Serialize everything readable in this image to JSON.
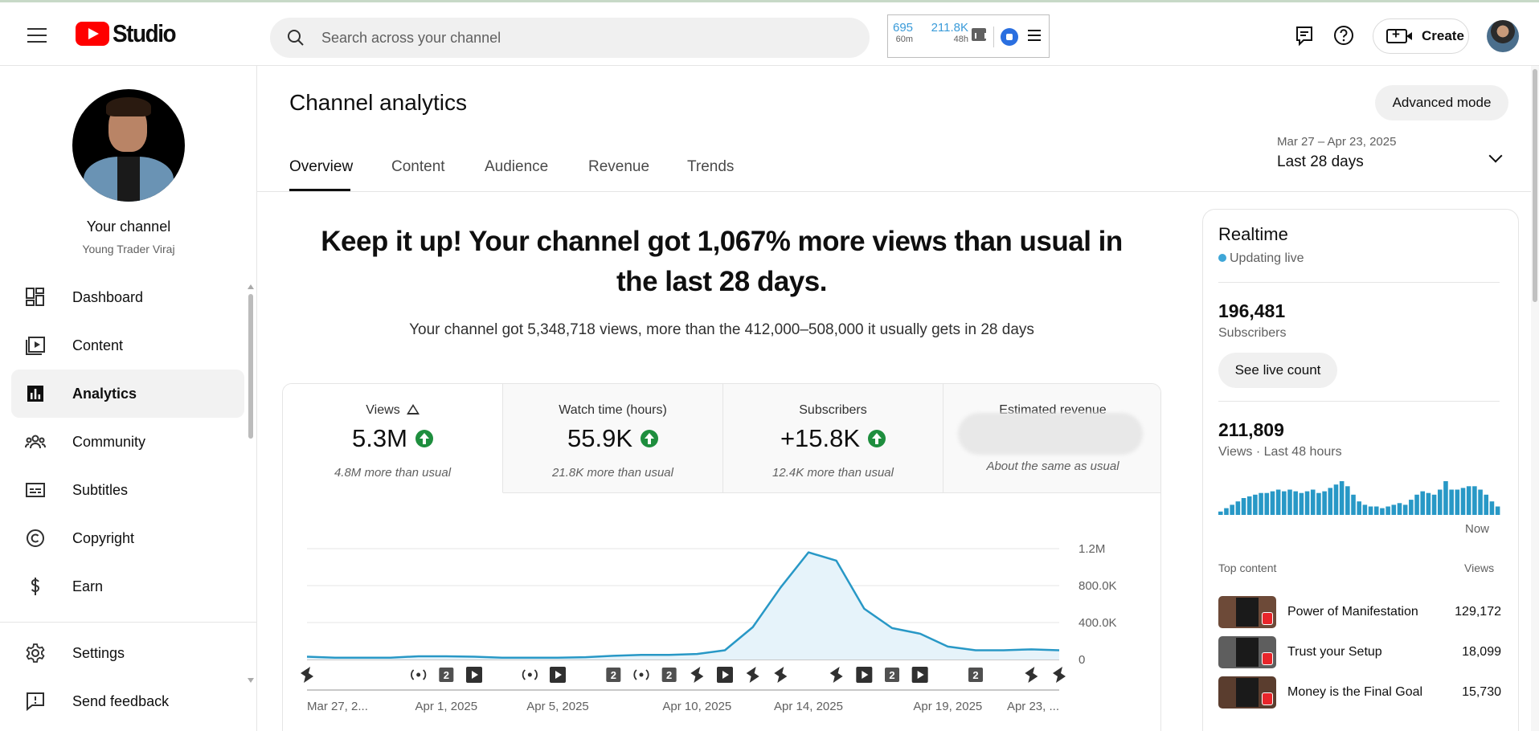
{
  "app": {
    "logo_text": "Studio"
  },
  "search": {
    "placeholder": "Search across your channel"
  },
  "extension": {
    "views_60m": "695",
    "views_60m_label": "60m",
    "views_48h": "211.8K",
    "views_48h_label": "48h"
  },
  "topbar": {
    "create_label": "Create"
  },
  "sidebar": {
    "channel_title": "Your channel",
    "channel_name": "Young Trader Viraj",
    "items": [
      {
        "label": "Dashboard",
        "icon": "dashboard-icon"
      },
      {
        "label": "Content",
        "icon": "content-icon"
      },
      {
        "label": "Analytics",
        "icon": "analytics-icon",
        "active": true
      },
      {
        "label": "Community",
        "icon": "community-icon"
      },
      {
        "label": "Subtitles",
        "icon": "subtitles-icon"
      },
      {
        "label": "Copyright",
        "icon": "copyright-icon"
      },
      {
        "label": "Earn",
        "icon": "dollar-icon"
      },
      {
        "label": "Settings",
        "icon": "gear-icon"
      },
      {
        "label": "Send feedback",
        "icon": "feedback-icon"
      }
    ]
  },
  "page": {
    "title": "Channel analytics",
    "advanced_mode": "Advanced mode",
    "tabs": [
      "Overview",
      "Content",
      "Audience",
      "Revenue",
      "Trends"
    ],
    "date_range": "Mar 27 – Apr 23, 2025",
    "date_label": "Last 28 days",
    "headline": "Keep it up! Your channel got 1,067% more views than usual in the last 28 days.",
    "subline": "Your channel got 5,348,718 views, more than the 412,000–508,000 it usually gets in 28 days"
  },
  "metrics": [
    {
      "label": "Views",
      "value": "5.3M",
      "note": "4.8M more than usual"
    },
    {
      "label": "Watch time (hours)",
      "value": "55.9K",
      "note": "21.8K more than usual"
    },
    {
      "label": "Subscribers",
      "value": "+15.8K",
      "note": "12.4K more than usual"
    },
    {
      "label": "Estimated revenue",
      "value": "",
      "note": "About the same as usual"
    }
  ],
  "chart_data": {
    "type": "area",
    "x": [
      "Mar 27",
      "Mar 28",
      "Mar 29",
      "Mar 30",
      "Mar 31",
      "Apr 1",
      "Apr 2",
      "Apr 3",
      "Apr 4",
      "Apr 5",
      "Apr 6",
      "Apr 7",
      "Apr 8",
      "Apr 9",
      "Apr 10",
      "Apr 11",
      "Apr 12",
      "Apr 13",
      "Apr 14",
      "Apr 15",
      "Apr 16",
      "Apr 17",
      "Apr 18",
      "Apr 19",
      "Apr 20",
      "Apr 21",
      "Apr 22",
      "Apr 23"
    ],
    "values": [
      30000,
      20000,
      20000,
      20000,
      35000,
      35000,
      30000,
      20000,
      20000,
      20000,
      25000,
      40000,
      50000,
      50000,
      60000,
      100000,
      350000,
      780000,
      1160000,
      1070000,
      550000,
      340000,
      280000,
      140000,
      100000,
      100000,
      110000,
      100000
    ],
    "xticks": [
      "Mar 27, 2...",
      "Apr 1, 2025",
      "Apr 5, 2025",
      "Apr 10, 2025",
      "Apr 14, 2025",
      "Apr 19, 2025",
      "Apr 23, ..."
    ],
    "yticks": [
      "0",
      "400.0K",
      "800.0K",
      "1.2M"
    ],
    "ylim": [
      0,
      1200000
    ],
    "color": "#2898c6",
    "fill": "#e6f3fa",
    "markers": [
      {
        "day": 0,
        "type": "short"
      },
      {
        "day": 4,
        "type": "live"
      },
      {
        "day": 5,
        "type": "count",
        "text": "2"
      },
      {
        "day": 6,
        "type": "video"
      },
      {
        "day": 8,
        "type": "live"
      },
      {
        "day": 9,
        "type": "video"
      },
      {
        "day": 11,
        "type": "count",
        "text": "2"
      },
      {
        "day": 12,
        "type": "live"
      },
      {
        "day": 13,
        "type": "count",
        "text": "2"
      },
      {
        "day": 14,
        "type": "short"
      },
      {
        "day": 15,
        "type": "video"
      },
      {
        "day": 16,
        "type": "short"
      },
      {
        "day": 17,
        "type": "short"
      },
      {
        "day": 19,
        "type": "short"
      },
      {
        "day": 20,
        "type": "video"
      },
      {
        "day": 21,
        "type": "count",
        "text": "2"
      },
      {
        "day": 22,
        "type": "video"
      },
      {
        "day": 24,
        "type": "count",
        "text": "2"
      },
      {
        "day": 26,
        "type": "short"
      },
      {
        "day": 27,
        "type": "short"
      }
    ]
  },
  "realtime": {
    "title": "Realtime",
    "status": "Updating live",
    "subscribers": "196,481",
    "subscribers_label": "Subscribers",
    "live_count_btn": "See live count",
    "views": "211,809",
    "views_label": "Views · Last 48 hours",
    "now_label": "Now",
    "top_content_label": "Top content",
    "views_col_label": "Views",
    "bar_color": "#2898c6",
    "hourly_bars": [
      2,
      4,
      6,
      8,
      10,
      11,
      12,
      13,
      13,
      14,
      15,
      14,
      15,
      14,
      13,
      14,
      15,
      13,
      14,
      16,
      18,
      20,
      17,
      12,
      8,
      6,
      5,
      5,
      4,
      5,
      6,
      7,
      6,
      9,
      12,
      14,
      13,
      12,
      15,
      20,
      15,
      15,
      16,
      17,
      17,
      15,
      12,
      8,
      5
    ],
    "top_content": [
      {
        "title": "Power of Manifestation",
        "views": "129,172"
      },
      {
        "title": "Trust your Setup",
        "views": "18,099"
      },
      {
        "title": "Money is the Final Goal",
        "views": "15,730"
      }
    ]
  }
}
